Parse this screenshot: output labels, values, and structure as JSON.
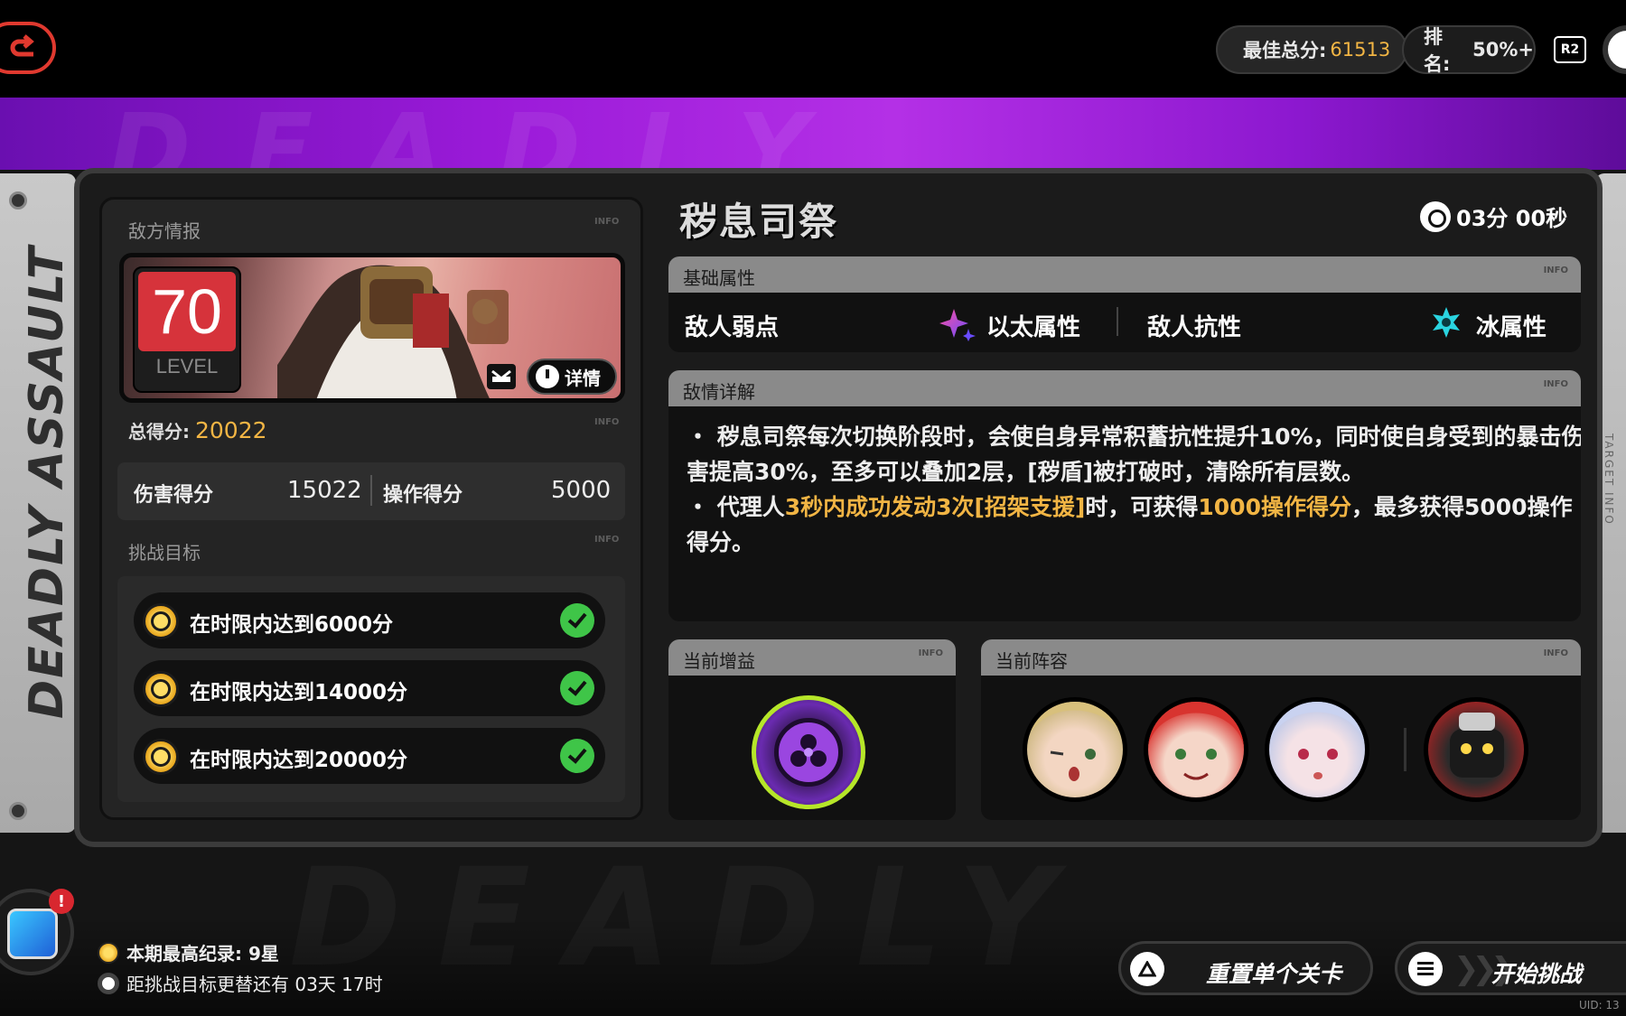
{
  "topbar": {
    "best_score_label": "最佳总分:",
    "best_score_value": "61513",
    "rank_label": "排名:",
    "rank_value": "50%+",
    "r2_label": "R2"
  },
  "banner": {
    "watermark": "DEADLY"
  },
  "side": {
    "rail_text": "DEADLY ASSAULT",
    "right_text": "TARGET INFO"
  },
  "enemy": {
    "section_label": "敌方情报",
    "info_tag": "INFO",
    "level": "70",
    "level_label": "LEVEL",
    "detail_button": "详情",
    "total_score_label": "总得分:",
    "total_score_value": "20022",
    "damage_score_label": "伤害得分",
    "damage_score_value": "15022",
    "action_score_label": "操作得分",
    "action_score_value": "5000"
  },
  "goals": {
    "section_label": "挑战目标",
    "items": [
      {
        "text": "在时限内达到6000分",
        "done": true
      },
      {
        "text": "在时限内达到14000分",
        "done": true
      },
      {
        "text": "在时限内达到20000分",
        "done": true
      }
    ]
  },
  "boss": {
    "name": "秽息司祭",
    "timer": "03分 00秒"
  },
  "attributes": {
    "header": "基础属性",
    "weakness_label": "敌人弱点",
    "weakness_value": "以太属性",
    "resist_label": "敌人抗性",
    "resist_value": "冰属性"
  },
  "details": {
    "header": "敌情详解",
    "p1": "・ 秽息司祭每次切换阶段时，会使自身异常积蓄抗性提升10%，同时使自身受到的暴击伤害提高30%，至多可以叠加2层，[秽盾]被打破时，清除所有层数。",
    "p2_pre": "・ 代理人",
    "p2_hl1": "3秒内成功发动3次[招架支援]",
    "p2_mid": "时，可获得",
    "p2_hl2": "1000操作得分",
    "p2_post": "，最多获得5000操作得分。"
  },
  "buff": {
    "header": "当前增益",
    "icon": "ether-buff-icon"
  },
  "team": {
    "header": "当前阵容",
    "members": [
      "agent-1-avatar",
      "agent-2-avatar",
      "agent-3-avatar",
      "bangboo-avatar"
    ]
  },
  "bottom": {
    "record": "本期最高纪录: 9星",
    "countdown": "距挑战目标更替还有 03天 17时",
    "reset_button": "重置单个关卡",
    "start_button": "开始挑战",
    "uid": "UID: 13"
  },
  "colors": {
    "accent": "#f2b544",
    "level_red": "#d6333b",
    "check_green": "#3fc548",
    "banner_purple": "#b430e6"
  }
}
